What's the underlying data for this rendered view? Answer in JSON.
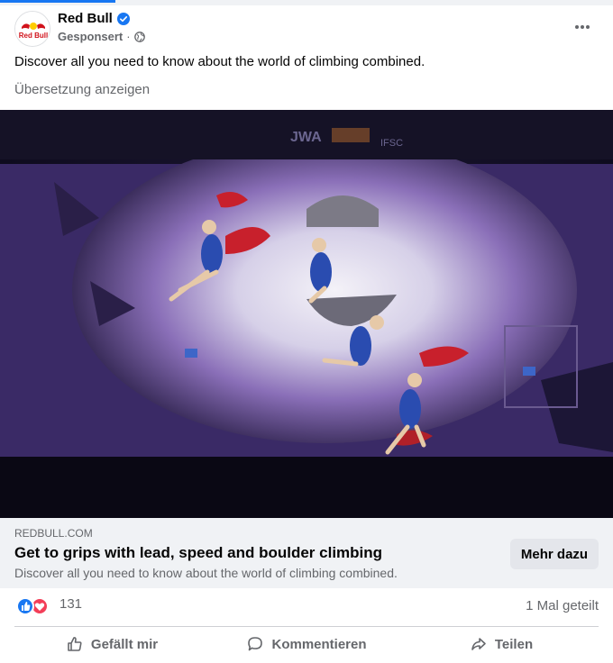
{
  "post": {
    "page_name": "Red Bull",
    "verified": true,
    "sponsored_label": "Gesponsert",
    "separator": "·",
    "audience_icon": "globe-icon",
    "more_icon": "more-options-icon",
    "text": "Discover all you need to know about the world of climbing combined.",
    "translate_link": "Übersetzung anzeigen",
    "avatar_logo_text": "Red Bull"
  },
  "media": {
    "description_icon": "climbing-photo",
    "wall_signage": [
      "JWA",
      "IFSC"
    ]
  },
  "link_preview": {
    "domain": "REDBULL.COM",
    "title": "Get to grips with lead, speed and boulder climbing",
    "description": "Discover all you need to know about the world of climbing combined.",
    "cta_label": "Mehr dazu"
  },
  "engagement": {
    "reaction_count": "131",
    "shares": "1 Mal geteilt",
    "reaction_icons": [
      "like-icon",
      "love-icon"
    ]
  },
  "actions": {
    "like": "Gefällt mir",
    "comment": "Kommentieren",
    "share": "Teilen"
  },
  "colors": {
    "brand_blue": "#1877f2",
    "love_red": "#f33e58",
    "secondary_text": "#65676b",
    "card_bg": "#f0f2f5"
  }
}
